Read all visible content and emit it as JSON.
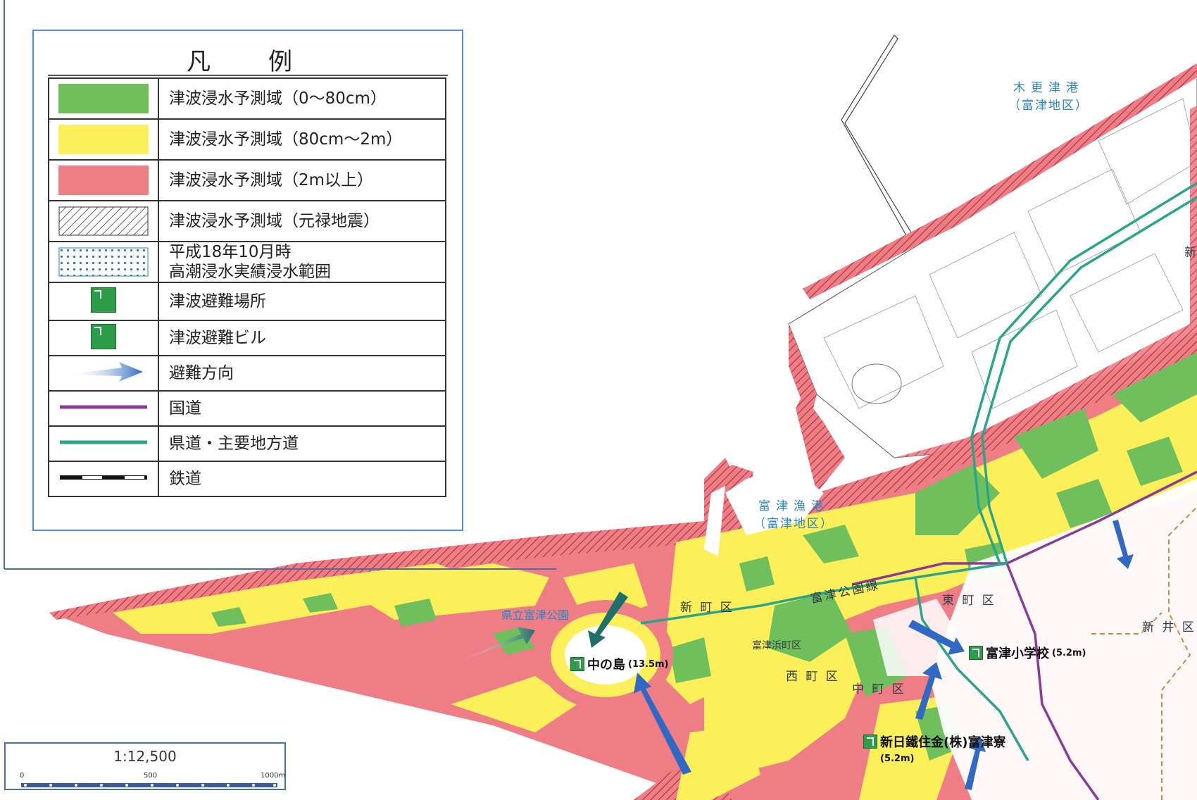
{
  "legend": {
    "title": "凡　例",
    "items": [
      {
        "label": "津波浸水予測域（0～80cm）",
        "swatch": "fill",
        "color": "#6fbf5d",
        "icon": "green-swatch"
      },
      {
        "label": "津波浸水予測域（80cm～2m）",
        "swatch": "fill",
        "color": "#fbf05a",
        "icon": "yellow-swatch"
      },
      {
        "label": "津波浸水予測域（2m以上）",
        "swatch": "fill",
        "color": "#ef7d86",
        "icon": "red-swatch"
      },
      {
        "label": "津波浸水予測域（元禄地震）",
        "swatch": "hatch",
        "color": "#333333",
        "icon": "hatch-swatch"
      },
      {
        "label": "平成18年10月時",
        "label2": "高潮浸水実績浸水範囲",
        "swatch": "dots",
        "color": "#2a78c8",
        "icon": "dot-swatch"
      },
      {
        "label": "津波避難場所",
        "swatch": "icon",
        "color": "#2e9d49",
        "icon": "evacuation-site-icon"
      },
      {
        "label": "津波避難ビル",
        "swatch": "icon",
        "color": "#2e9d49",
        "icon": "evacuation-building-icon"
      },
      {
        "label": "避難方向",
        "swatch": "arrow",
        "color": "#2f69c4",
        "icon": "evacuation-arrow-icon"
      },
      {
        "label": "国道",
        "swatch": "line",
        "color": "#8a3b9a",
        "icon": "national-road-line"
      },
      {
        "label": "県道・主要地方道",
        "swatch": "line",
        "color": "#2aa58a",
        "icon": "prefectural-road-line"
      },
      {
        "label": "鉄道",
        "swatch": "rail",
        "color": "#111111",
        "icon": "railway-line"
      }
    ]
  },
  "labels": {
    "port1_line1": "木更津港",
    "port1_line2": "（富津地区）",
    "port2_line1": "富津漁港",
    "port2_line2": "（富津地区）",
    "park": "県立富津公園",
    "road": "富津公園線",
    "shinmachi": "新 町 区",
    "higashimachi": "東 町 区",
    "araimachi": "新 井 区",
    "futtsuhama": "富津浜町区",
    "nishimachi": "西 町 区",
    "nakamachi": "中 町 区",
    "edge": "新"
  },
  "shelters": [
    {
      "name": "中の島",
      "height": "(13.5m)"
    },
    {
      "name": "富津小学校",
      "height": "(5.2m)"
    },
    {
      "name": "新日鐵住金(株)富津寮",
      "height": "(5.2m)"
    }
  ],
  "scale": {
    "ratio": "1:12,500",
    "ticks": [
      "0",
      "500",
      "1000m"
    ]
  },
  "colors": {
    "zone_low": "#6fbf5d",
    "zone_mid": "#fbf05a",
    "zone_high": "#ef7d86",
    "national_road": "#8a3b9a",
    "prefectural_road": "#2aa58a",
    "legend_border": "#4d8fcc"
  }
}
